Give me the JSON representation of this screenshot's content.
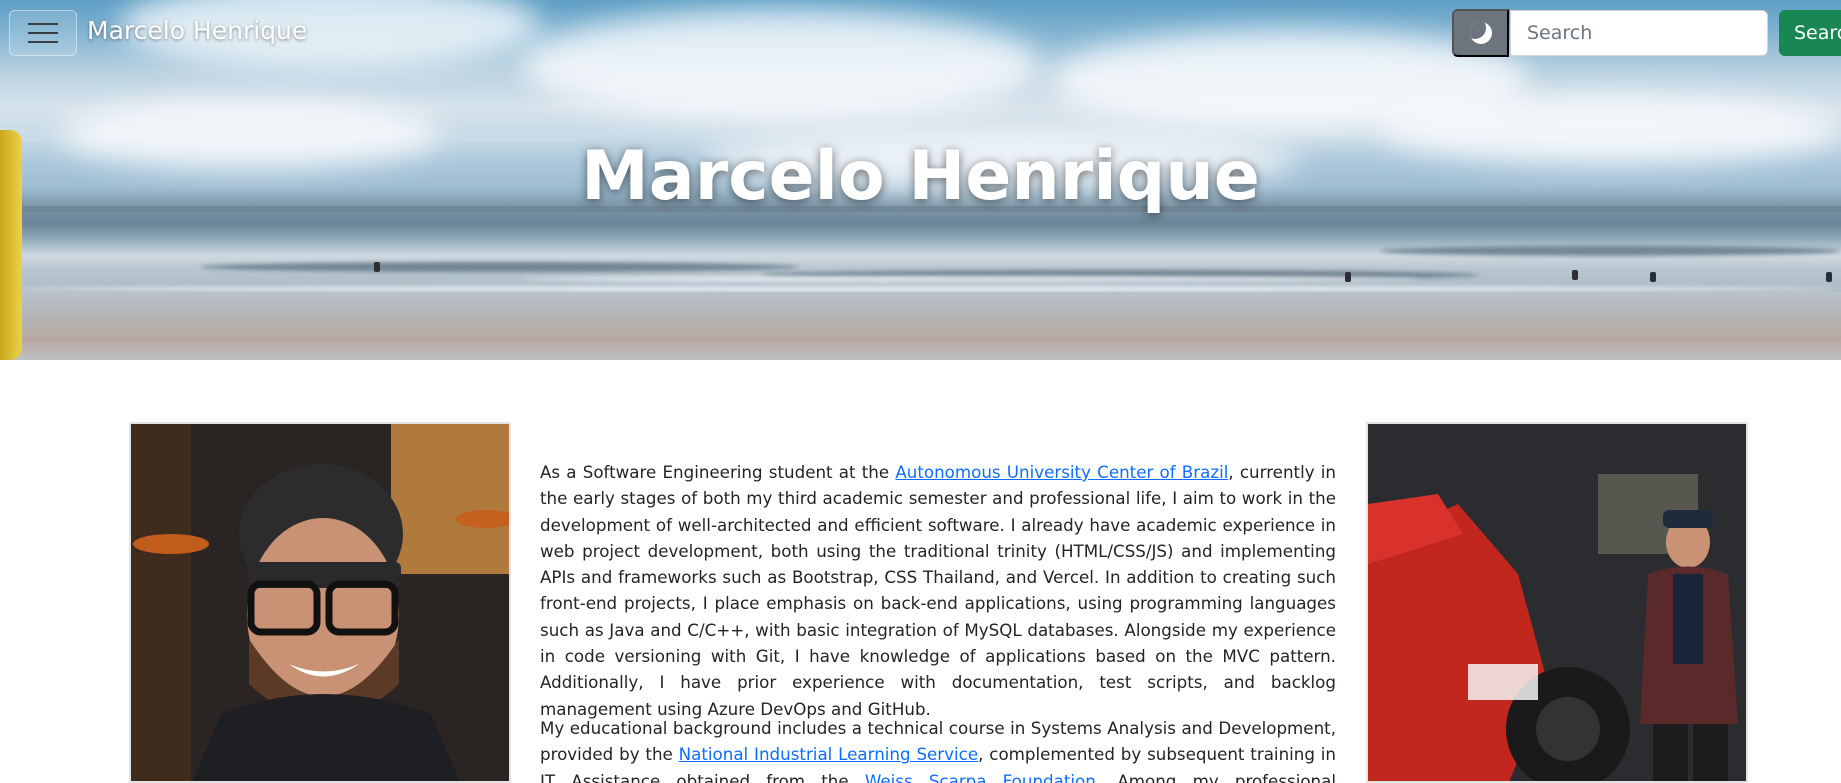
{
  "navbar": {
    "brand": "Marcelo Henrique",
    "search_placeholder": "Search",
    "search_button": "Search",
    "theme_icon": "moon-icon",
    "menu_icon": "hamburger-icon"
  },
  "hero": {
    "title": "Marcelo Henrique"
  },
  "colors": {
    "search_button": "#198754",
    "theme_button": "#6c757d",
    "link": "#0d6efd",
    "text": "#212529"
  },
  "about": {
    "p1": {
      "pre": "As a Software Engineering student at the ",
      "link": "Autonomous University Center of Brazil",
      "post": ", currently in the early stages of both my third academic semester and professional life, I aim to work in the development of well-architected and efficient software. I already have academic experience in web project development, both using the traditional trinity (HTML/CSS/JS) and implementing APIs and frameworks such as Bootstrap, CSS Thailand, and Vercel. In addition to creating such front-end projects, I place emphasis on back-end applications, using programming languages such as Java and C/C++, with basic integration of MySQL databases. Alongside my experience in code versioning with Git, I have knowledge of applications based on the MVC pattern. Additionally, I have prior experience with documentation, test scripts, and backlog management using Azure DevOps and GitHub."
    },
    "p2": {
      "pre": "My educational background includes a technical course in Systems Analysis and Development, provided by the ",
      "link1": "National Industrial Learning Service",
      "mid": ", complemented by subsequent training in IT Assistance obtained from the ",
      "link2": "Weiss Scarpa Foundation",
      "post": ". Among my professional experiences, I recently"
    }
  }
}
